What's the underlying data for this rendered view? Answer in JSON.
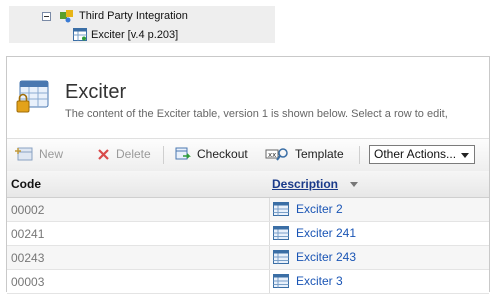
{
  "tree": {
    "parent_label": "Third Party Integration",
    "child_label": "Exciter [v.4 p.203]"
  },
  "header": {
    "title": "Exciter",
    "description": "The content of the Exciter table, version 1 is shown below. Select a row to edit,"
  },
  "toolbar": {
    "new_label": "New",
    "delete_label": "Delete",
    "checkout_label": "Checkout",
    "template_label": "Template",
    "other_actions_label": "Other Actions..."
  },
  "table": {
    "columns": [
      "Code",
      "Description"
    ],
    "rows": [
      {
        "code": "00002",
        "description": "Exciter 2"
      },
      {
        "code": "00241",
        "description": "Exciter 241"
      },
      {
        "code": "00243",
        "description": "Exciter 243"
      },
      {
        "code": "00003",
        "description": "Exciter 3"
      }
    ]
  },
  "colors": {
    "link": "#1a55b5",
    "header_link": "#1a3a8a",
    "tree_bg": "#eeeeee"
  },
  "icons": {
    "tree_parent": "puzzle-icon",
    "tree_child": "table-icon",
    "header": "locked-table-icon",
    "row": "record-icon"
  }
}
